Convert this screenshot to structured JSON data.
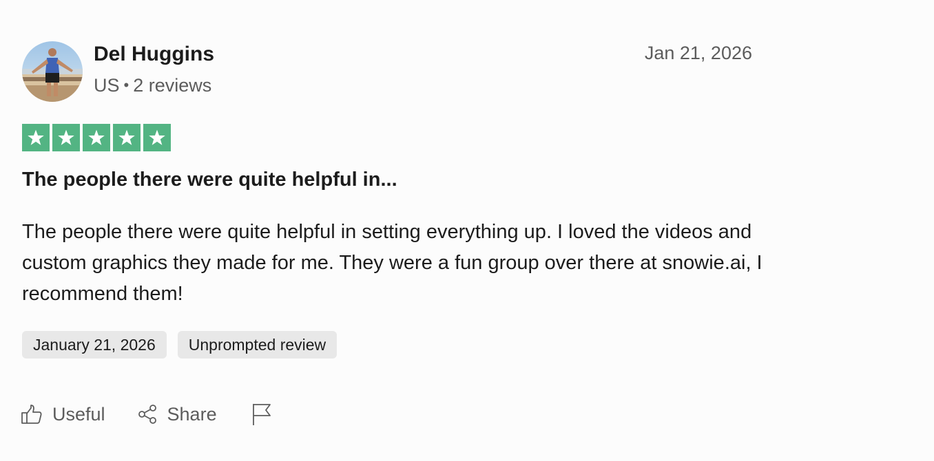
{
  "reviewer": {
    "name": "Del Huggins",
    "country": "US",
    "separator": "•",
    "reviews_count": "2 reviews",
    "avatar_icon": "user-photo"
  },
  "review": {
    "date": "Jan 21, 2026",
    "rating": 5,
    "rating_max": 5,
    "star_color": "#53b483",
    "title": "The people there were quite helpful in...",
    "body": "The people there were quite helpful in setting everything up. I loved the videos and custom graphics they made for me. They were a fun group over there at snowie.ai, I recommend them!",
    "tags": [
      "January 21, 2026",
      "Unprompted review"
    ]
  },
  "actions": {
    "useful_label": "Useful",
    "useful_icon": "thumbs-up-icon",
    "share_label": "Share",
    "share_icon": "share-icon",
    "flag_icon": "flag-icon"
  }
}
